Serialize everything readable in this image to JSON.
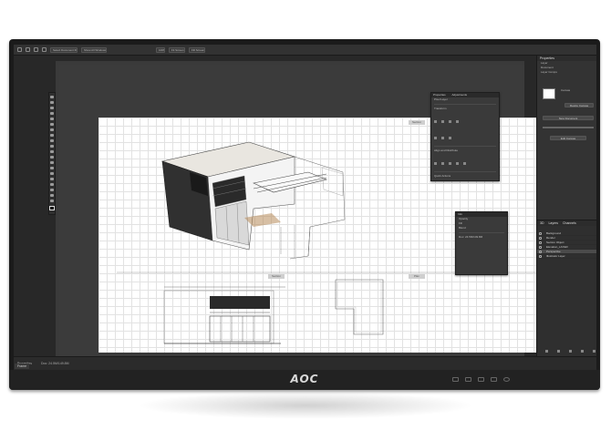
{
  "monitor": {
    "brand": "AOC"
  },
  "app": {
    "options_bar": {
      "fields": [
        "Select Document ID",
        "Show All Windows",
        "100%",
        "Fit Screen",
        "Fill Screen"
      ]
    },
    "document_tab": "Frame",
    "status": {
      "zoom": "Properties",
      "doc_info": "Doc: 24.5M/149.8M"
    },
    "page_labels": [
      "Section",
      "Section",
      "Plan"
    ]
  },
  "properties_panel_floating": {
    "tabs": [
      "Properties",
      "Adjustments"
    ],
    "rows": [
      "Pixel Layer",
      "Transform",
      "Align and Distribute",
      "Quick Actions"
    ]
  },
  "info_panel_floating": {
    "title": "Info",
    "rows": [
      "Opacity",
      "Fill",
      "Blend",
      "Doc: 24.5M/149.8M"
    ]
  },
  "right_dock": {
    "properties": {
      "title": "Properties",
      "rows": [
        "Layer",
        "Document",
        "Layer Comps",
        "Canvas"
      ],
      "buttons": [
        "Resize Canvas",
        "New Document",
        "Edit Canvas"
      ]
    },
    "layers": {
      "tabs": [
        "3D",
        "Layers",
        "Channels"
      ],
      "items": [
        "Background",
        "Render",
        "Section Object",
        "Elevation_LAYER",
        "Perspective",
        "Illustrator Layer"
      ]
    }
  }
}
